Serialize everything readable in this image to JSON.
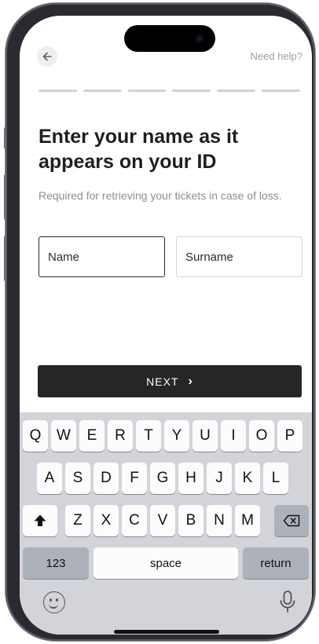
{
  "header": {
    "back_icon": "arrow-left-icon",
    "help_label": "Need help?"
  },
  "progress": {
    "total_steps": 6
  },
  "content": {
    "title": "Enter your name as it appears on your ID",
    "subtitle": "Required for retrieving your tickets in case of loss."
  },
  "form": {
    "name_placeholder": "Name",
    "surname_placeholder": "Surname"
  },
  "next_button": {
    "label": "NEXT",
    "icon": "chevron-right-icon"
  },
  "keyboard": {
    "row1": [
      "Q",
      "W",
      "E",
      "R",
      "T",
      "Y",
      "U",
      "I",
      "O",
      "P"
    ],
    "row2": [
      "A",
      "S",
      "D",
      "F",
      "G",
      "H",
      "J",
      "K",
      "L"
    ],
    "row3": [
      "Z",
      "X",
      "C",
      "V",
      "B",
      "N",
      "M"
    ],
    "numbers_label": "123",
    "space_label": "space",
    "return_label": "return",
    "shift_icon": "shift-icon",
    "delete_icon": "backspace-icon",
    "emoji_icon": "emoji-icon",
    "mic_icon": "microphone-icon"
  },
  "colors": {
    "button_bg": "#262626",
    "keyboard_bg": "#d2d4da",
    "muted_text": "#8b8f94"
  }
}
